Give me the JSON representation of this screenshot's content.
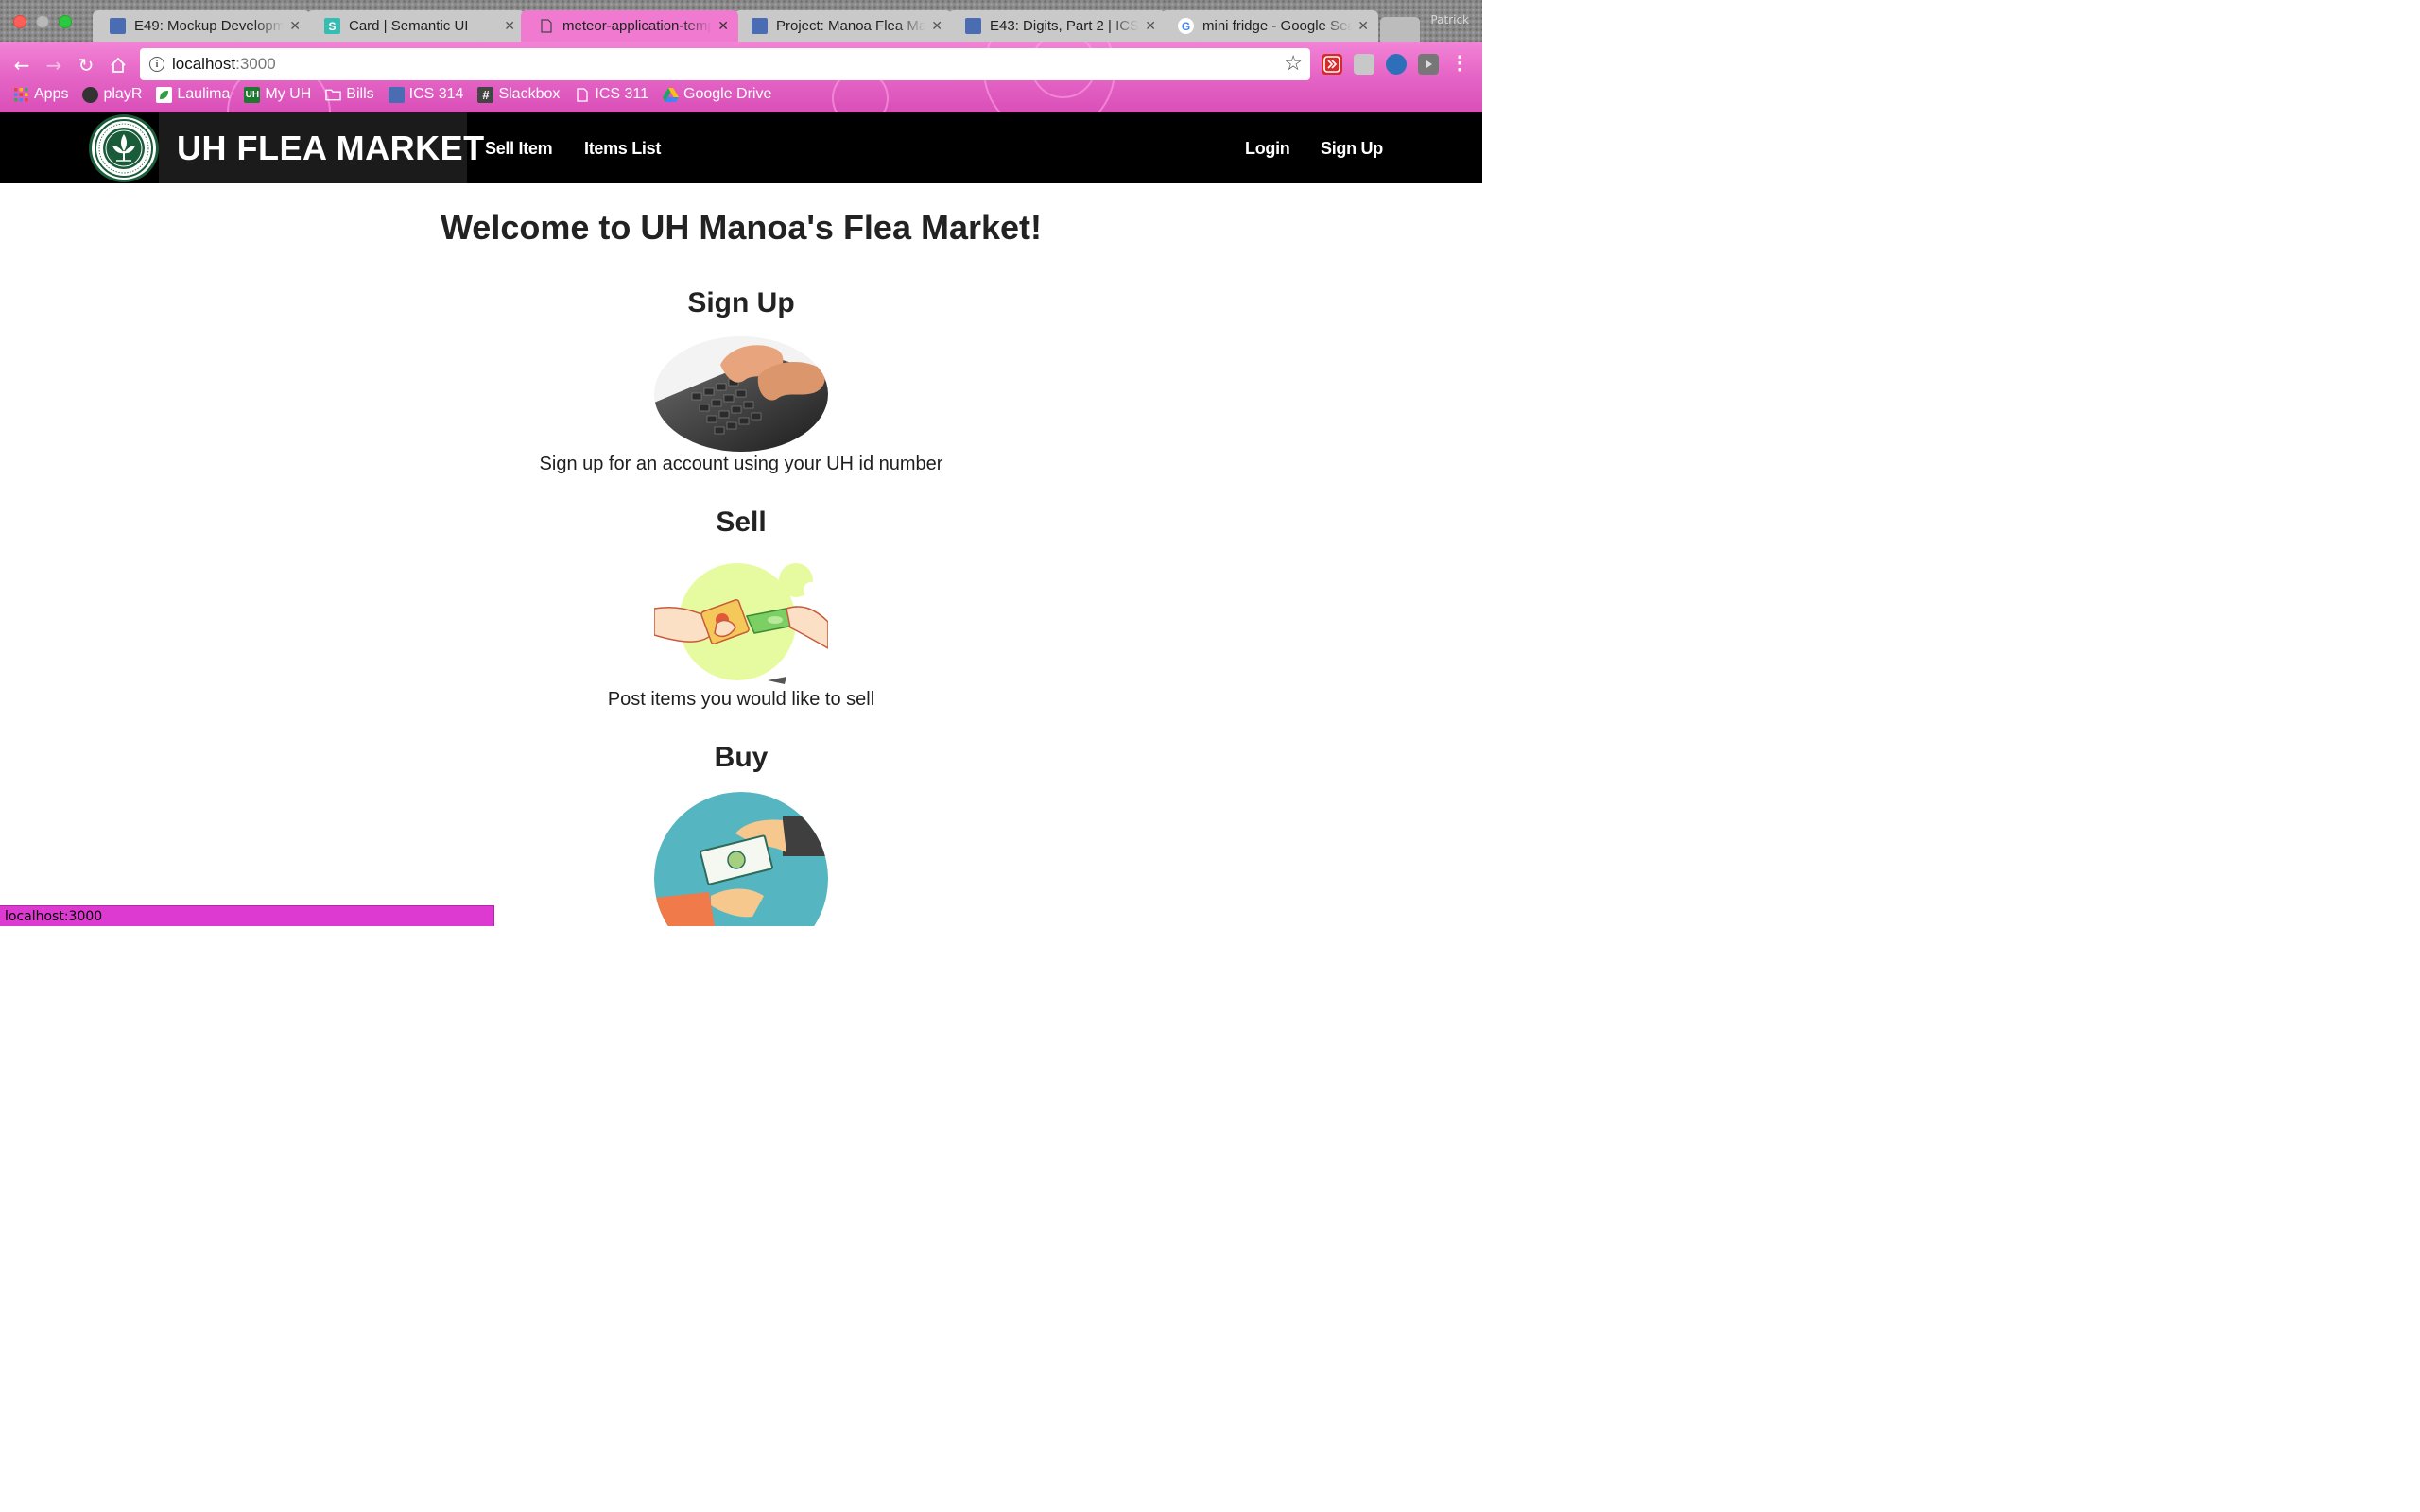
{
  "browser": {
    "profile": "Patrick",
    "tabs": [
      {
        "title": "E49: Mockup Development",
        "icon": "page-icon",
        "favicon_color": "#4a6cb3"
      },
      {
        "title": "Card | Semantic UI",
        "icon": "semantic-ui-icon",
        "favicon_color": "#35bdb2",
        "glyph": "S"
      },
      {
        "title": "meteor-application-template",
        "icon": "document-icon",
        "favicon_color": "#f07ad0"
      },
      {
        "title": "Project: Manoa Flea Market",
        "icon": "page-icon",
        "favicon_color": "#4a6cb3"
      },
      {
        "title": "E43: Digits, Part 2 | ICS 314",
        "icon": "page-icon",
        "favicon_color": "#4a6cb3"
      },
      {
        "title": "mini fridge - Google Search",
        "icon": "google-icon",
        "favicon_color": "#ffffff",
        "glyph": "G"
      }
    ],
    "address": {
      "host": "localhost",
      "port": ":3000"
    },
    "bookmarks": [
      {
        "label": "Apps",
        "icon": "apps-grid-icon",
        "color": "#e94235"
      },
      {
        "label": "playR",
        "icon": "playr-icon",
        "color": "#333333"
      },
      {
        "label": "Laulima",
        "icon": "leaf-icon",
        "color": "#2e9e3e"
      },
      {
        "label": "My UH",
        "icon": "uh-icon",
        "color": "#1b7a2e",
        "glyph": "UH"
      },
      {
        "label": "Bills",
        "icon": "folder-icon",
        "color": "#f0f0f0"
      },
      {
        "label": "ICS 314",
        "icon": "page-icon",
        "color": "#4a6cb3"
      },
      {
        "label": "Slackbox",
        "icon": "hashtag-icon",
        "color": "#444444",
        "glyph": "#"
      },
      {
        "label": "ICS 311",
        "icon": "document-icon",
        "color": "#ffffff"
      },
      {
        "label": "Google Drive",
        "icon": "google-drive-icon",
        "color": "#1fa463"
      }
    ],
    "status_url": "localhost:3000"
  },
  "navbar": {
    "brand": "UH FLEA MARKET",
    "left_items": [
      "Sell Item",
      "Items List"
    ],
    "right_items": [
      "Login",
      "Sign Up"
    ]
  },
  "main": {
    "welcome": "Welcome to UH Manoa's Flea Market!",
    "sections": [
      {
        "heading": "Sign Up",
        "text": "Sign up for an account using your UH id number",
        "image": "keyboard-typing-image"
      },
      {
        "heading": "Sell",
        "text": "Post items you would like to sell",
        "image": "exchange-hands-image"
      },
      {
        "heading": "Buy",
        "text": "",
        "image": "money-handoff-image"
      }
    ]
  }
}
